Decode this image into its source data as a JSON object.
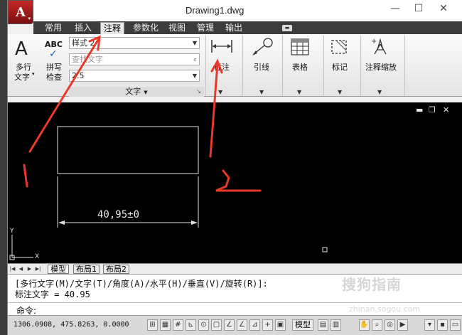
{
  "window": {
    "title": "Drawing1.dwg",
    "minimize": "—",
    "maximize": "☐",
    "close": "✕"
  },
  "app_button": {
    "letter": "A",
    "dropdown": "▾"
  },
  "menu_tabs": [
    "常用",
    "插入",
    "注释",
    "参数化",
    "视图",
    "管理",
    "输出"
  ],
  "active_tab": "注释",
  "ribbon": {
    "multiline_text": {
      "line1": "多行",
      "line2": "文字",
      "dropdown": "▾"
    },
    "spell_check": {
      "icon_text": "ABC",
      "line1": "拼写",
      "line2": "检查"
    },
    "text_style": "样式 2",
    "find_text_placeholder": "查找文字",
    "text_height": "2.5",
    "text_panel_title": "文字",
    "dimension": "标注",
    "leader": "引线",
    "table": "表格",
    "markup": "标记",
    "annotation_scaling": "注释缩放"
  },
  "drawing": {
    "dimension_text": "40,95±0",
    "ucs_y": "Y",
    "ucs_x": "X",
    "controls": [
      "▬",
      "❐",
      "✕"
    ]
  },
  "layout_tabs": [
    "模型",
    "布局1",
    "布局2"
  ],
  "active_layout": "模型",
  "command_history": [
    "[多行文字(M)/文字(T)/角度(A)/水平(H)/垂直(V)/旋转(R)]:",
    "标注文字 = 40.95"
  ],
  "command_prompt": "命令:",
  "status_bar": {
    "coordinates": "1306.0908, 475.8263, 0.0000",
    "model_label": "模型"
  },
  "annotations": {
    "mark_1": "1",
    "mark_2": "2"
  },
  "watermark": {
    "text": "搜狗指南",
    "subtext": "zhinan.sogou.com"
  },
  "colors": {
    "annotation_arrow": "#e8392b",
    "drawing_bg": "#000000",
    "app_red": "#b71c1c"
  }
}
